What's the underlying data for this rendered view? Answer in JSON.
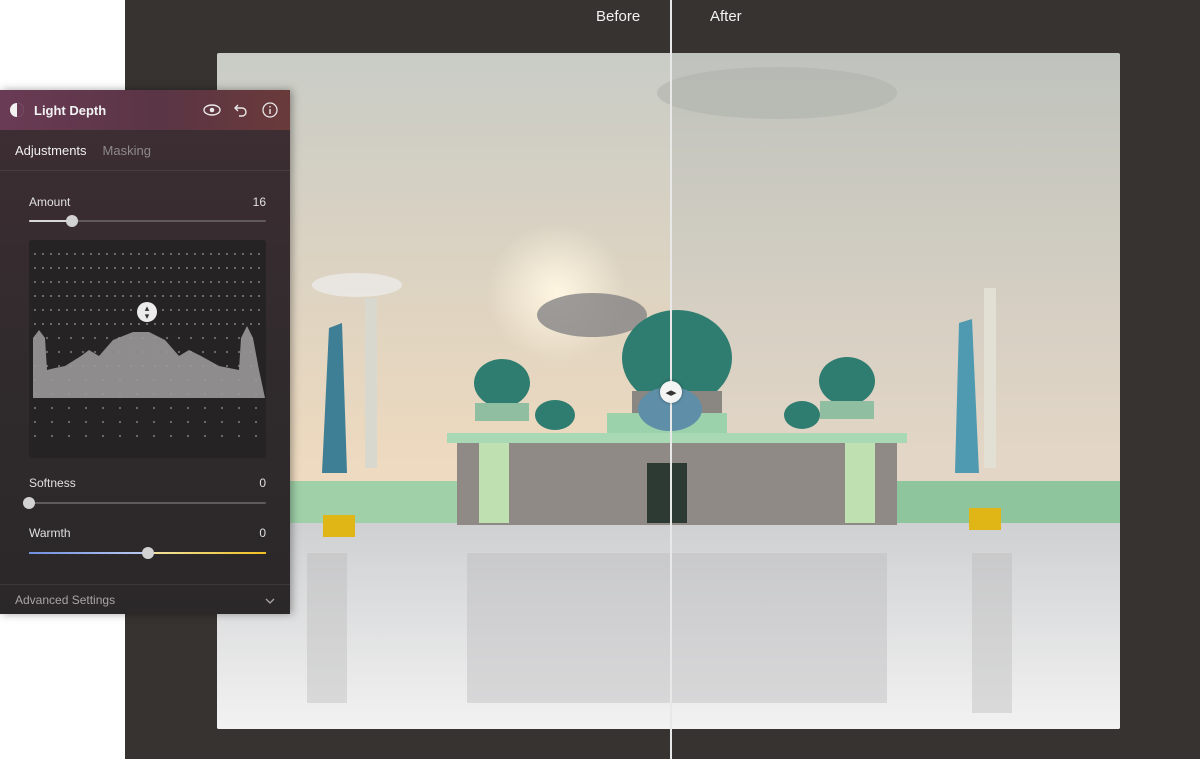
{
  "compare": {
    "before_label": "Before",
    "after_label": "After"
  },
  "panel": {
    "title": "Light Depth",
    "header_icons": [
      "eye-icon",
      "undo-icon",
      "info-icon"
    ],
    "tabs": [
      {
        "label": "Adjustments",
        "active": true
      },
      {
        "label": "Masking",
        "active": false
      }
    ],
    "amount": {
      "label": "Amount",
      "value": "16",
      "level": 0.18
    },
    "softness": {
      "label": "Softness",
      "value": "0",
      "level": 0
    },
    "warmth": {
      "label": "Warmth",
      "value": "0",
      "level": 0.5
    },
    "advanced": {
      "label": "Advanced Settings"
    }
  },
  "colors": {
    "panel_header": "#6a3b55",
    "workspace": "#363330",
    "warmth_cool": "#6f8fe0",
    "warmth_warm": "#f0c020"
  }
}
